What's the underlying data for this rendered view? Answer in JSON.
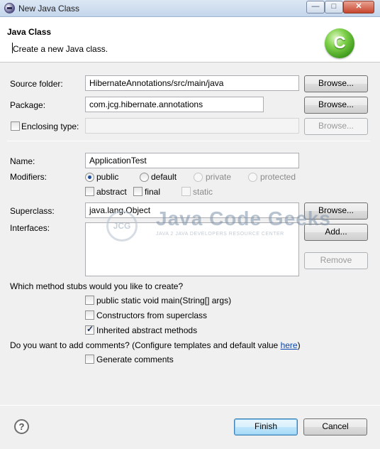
{
  "window": {
    "title": "New Java Class",
    "controls": {
      "minimize": "—",
      "maximize": "□",
      "close": "✕"
    }
  },
  "header": {
    "title": "Java Class",
    "description": "Create a new Java class.",
    "logo_letter": "C",
    "logo_icon": "java-class-c-icon"
  },
  "form": {
    "source_folder": {
      "label": "Source folder:",
      "value": "HibernateAnnotations/src/main/java",
      "button": "Browse..."
    },
    "package": {
      "label": "Package:",
      "value": "com.jcg.hibernate.annotations",
      "button": "Browse..."
    },
    "enclosing_type": {
      "label": "Enclosing type:",
      "value": "",
      "checked": false,
      "button": "Browse..."
    },
    "name": {
      "label": "Name:",
      "value": "ApplicationTest"
    },
    "modifiers": {
      "label": "Modifiers:",
      "access": [
        {
          "label": "public",
          "selected": true,
          "enabled": true
        },
        {
          "label": "default",
          "selected": false,
          "enabled": true
        },
        {
          "label": "private",
          "selected": false,
          "enabled": false
        },
        {
          "label": "protected",
          "selected": false,
          "enabled": false
        }
      ],
      "flags": [
        {
          "label": "abstract",
          "checked": false,
          "enabled": true
        },
        {
          "label": "final",
          "checked": false,
          "enabled": true
        },
        {
          "label": "static",
          "checked": false,
          "enabled": false
        }
      ]
    },
    "superclass": {
      "label": "Superclass:",
      "value": "java.lang.Object",
      "button": "Browse..."
    },
    "interfaces": {
      "label": "Interfaces:",
      "add_button": "Add...",
      "remove_button": "Remove"
    }
  },
  "stubs": {
    "question": "Which method stubs would you like to create?",
    "options": [
      {
        "label": "public static void main(String[] args)",
        "checked": false
      },
      {
        "label": "Constructors from superclass",
        "checked": false
      },
      {
        "label": "Inherited abstract methods",
        "checked": true
      }
    ]
  },
  "comments": {
    "question": "Do you want to add comments? (Configure templates and default value ",
    "link": "here",
    "question_end": ")",
    "option": {
      "label": "Generate comments",
      "checked": false
    }
  },
  "watermark": {
    "logo_text": "JCG",
    "main": "Java Code Geeks",
    "sub": "JAVA 2 JAVA DEVELOPERS RESOURCE CENTER"
  },
  "footer": {
    "help_icon": "?",
    "finish": "Finish",
    "cancel": "Cancel"
  }
}
